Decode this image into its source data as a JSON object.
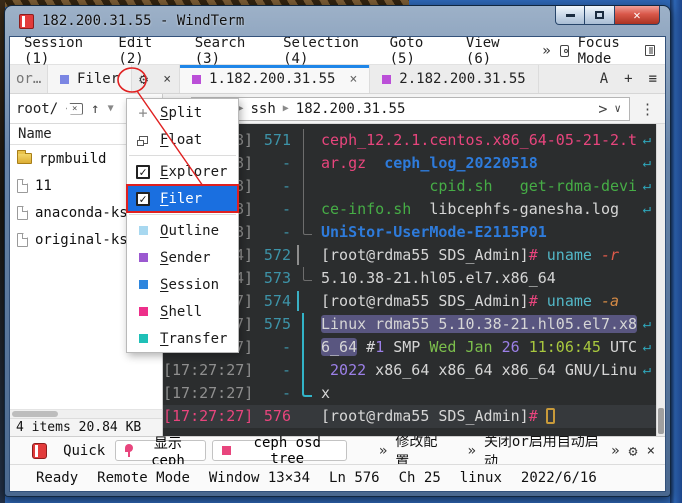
{
  "window": {
    "title": "182.200.31.55 - WindTerm"
  },
  "colors": {
    "pink": "#e8457d",
    "blue": "#2e7bdb",
    "green": "#46ad46",
    "white": "#d6d6d6",
    "cyan": "#52b7c7",
    "redit": "#e05a4a",
    "orangeit": "#d58a45",
    "violet": "#9c80e8",
    "green2": "#7cbf4c",
    "yellowgreen": "#a9c93e",
    "gray": "#8f8f8f",
    "teal": "#3d93a8",
    "wrap": "#2fa8bc",
    "annotation": "#e02020"
  },
  "menubar": {
    "items": [
      {
        "pre": "Session (",
        "key": "1",
        "post": ")"
      },
      {
        "pre": "Edit (",
        "key": "2",
        "post": ")"
      },
      {
        "pre": "Search (",
        "key": "3",
        "post": ")"
      },
      {
        "pre": "Selection (",
        "key": "4",
        "post": ")"
      },
      {
        "pre": "Goto (",
        "key": "5",
        "post": ")"
      },
      {
        "pre": "View (",
        "key": "6",
        "post": ")"
      }
    ],
    "overflow_glyph": "»",
    "focus_label": "Focus Mode"
  },
  "tabbar": {
    "left_tabs": [
      {
        "label": "or…",
        "muted": true
      },
      {
        "label": "Filer",
        "icon_color": "#7b86e3"
      }
    ],
    "gear_glyph": "⚙",
    "close_glyph": "×",
    "session_tabs": [
      {
        "label": "1.182.200.31.55",
        "icon_color": "#bb4fd8",
        "active": true,
        "closable": true
      },
      {
        "label": "2.182.200.31.55",
        "icon_color": "#bb4fd8",
        "active": false,
        "closable": false
      }
    ],
    "right_icons": [
      {
        "name": "font-size-icon",
        "glyph": "A"
      },
      {
        "name": "new-session-icon",
        "glyph": "+"
      },
      {
        "name": "session-list-icon",
        "glyph": "≡"
      }
    ]
  },
  "pathbar": {
    "path": "root/"
  },
  "addressbar": {
    "protocol": "ssh",
    "host": "182.200.31.55"
  },
  "popup_menu": {
    "items": [
      {
        "type": "icon",
        "icon": "split",
        "key": "S",
        "rest": "plit"
      },
      {
        "type": "icon",
        "icon": "float",
        "key": "F",
        "rest": "loat"
      },
      {
        "type": "check",
        "checked": true,
        "key": "E",
        "rest": "xplorer"
      },
      {
        "type": "check",
        "checked": true,
        "key": "F",
        "rest": "iler",
        "selected": true,
        "annotated": true
      },
      {
        "type": "color",
        "color": "#a8d8f0",
        "key": "O",
        "rest": "utline"
      },
      {
        "type": "color",
        "color": "#9b59d0",
        "key": "S",
        "rest": "ender"
      },
      {
        "type": "color",
        "color": "#2e86de",
        "key": "S",
        "rest": "ession"
      },
      {
        "type": "color",
        "color": "#ed2f8a",
        "key": "S",
        "rest": "hell"
      },
      {
        "type": "color",
        "color": "#1fc0b7",
        "key": "T",
        "rest": "ransfer"
      }
    ],
    "separators_after": [
      1,
      3
    ]
  },
  "sidebar": {
    "header": "Name",
    "files": [
      {
        "icon": "folder",
        "name": "rpmbuild"
      },
      {
        "icon": "file",
        "name": "11"
      },
      {
        "icon": "file",
        "name": "anaconda-ks.c"
      },
      {
        "icon": "file",
        "name": "original-ks.c"
      }
    ],
    "status": "4 items 20.84 KB"
  },
  "terminal": {
    "rows": [
      {
        "ts": "8]",
        "num": "571",
        "guide": "v",
        "wrap": true,
        "segs": [
          {
            "t": "ceph_12.2.1.centos.x86_64-05-21-2.t",
            "c": "pink"
          }
        ]
      },
      {
        "ts": "8]",
        "num": "-",
        "guide": "v",
        "wrap": true,
        "segs": [
          {
            "t": "ar.gz",
            "c": "pink"
          },
          {
            "t": "  ",
            "c": "white"
          },
          {
            "t": "ceph_log_20220518",
            "c": "blue"
          }
        ]
      },
      {
        "ts": "8]",
        "num": "-",
        "guide": "v",
        "wrap": true,
        "segs": [
          {
            "t": "            ",
            "c": "white"
          },
          {
            "t": "cpid.sh",
            "c": "green"
          },
          {
            "t": "   ",
            "c": "white"
          },
          {
            "t": "get-rdma-devi",
            "c": "green"
          }
        ]
      },
      {
        "ts": "8]",
        "num": "-",
        "guide": "v",
        "wrap": true,
        "segs": [
          {
            "t": "ce-info.sh",
            "c": "green"
          },
          {
            "t": "  ",
            "c": "white"
          },
          {
            "t": "libcephfs-ganesha.log",
            "c": "white"
          }
        ]
      },
      {
        "ts": "8]",
        "num": "-",
        "guide": "l",
        "segs": [
          {
            "t": "UniStor-UserMode-E2115P01",
            "c": "blue"
          }
        ]
      },
      {
        "ts": "4]",
        "num": "572",
        "fold": "gray",
        "segs": [
          {
            "t": "[root@rdma55 SDS_Admin]",
            "c": "white"
          },
          {
            "t": "#",
            "c": "pink"
          },
          {
            "t": " ",
            "c": "white"
          },
          {
            "t": "uname",
            "c": "cyan"
          },
          {
            "t": " ",
            "c": "white"
          },
          {
            "t": "-r",
            "c": "redit"
          }
        ]
      },
      {
        "ts": "4]",
        "num": "573",
        "guide": "l",
        "segs": [
          {
            "t": "5.10.38-21.hl05.el7.x86_64",
            "c": "white"
          }
        ]
      },
      {
        "ts": "7]",
        "num": "574",
        "fold": "teal",
        "segs": [
          {
            "t": "[root@rdma55 SDS_Admin]",
            "c": "white"
          },
          {
            "t": "#",
            "c": "pink"
          },
          {
            "t": " ",
            "c": "white"
          },
          {
            "t": "uname",
            "c": "cyan"
          },
          {
            "t": " ",
            "c": "white"
          },
          {
            "t": "-a",
            "c": "orangeit"
          }
        ]
      },
      {
        "ts": "7]",
        "num": "575",
        "guide": "vt",
        "wrap": true,
        "segs": [
          {
            "t": "Linux rdma55 5.10.38-21.hl05.el7.x8",
            "c": "white",
            "sel": true
          }
        ]
      },
      {
        "ts": "7]",
        "num": "-",
        "guide": "vt",
        "wrap": true,
        "segs": [
          {
            "t": "6_64",
            "c": "white",
            "sel": true
          },
          {
            "t": " ",
            "c": "white"
          },
          {
            "t": "#",
            "c": "white"
          },
          {
            "t": "1",
            "c": "violet"
          },
          {
            "t": " SMP ",
            "c": "white"
          },
          {
            "t": "Wed Jan",
            "c": "green2"
          },
          {
            "t": " ",
            "c": "white"
          },
          {
            "t": "26",
            "c": "violet"
          },
          {
            "t": " ",
            "c": "white"
          },
          {
            "t": "11:06:45",
            "c": "yellowgreen"
          },
          {
            "t": " ",
            "c": "white"
          },
          {
            "t": "UTC",
            "c": "white"
          }
        ]
      },
      {
        "ts": "[17:27:27]",
        "num": "-",
        "guide": "vt",
        "wrap": true,
        "segs": [
          {
            "t": " ",
            "c": "white"
          },
          {
            "t": "2022",
            "c": "violet"
          },
          {
            "t": " x86_64 x86_64 x86_64 GNU/Linu",
            "c": "white"
          }
        ]
      },
      {
        "ts": "[17:27:27]",
        "num": "-",
        "guide": "lt",
        "segs": [
          {
            "t": "x",
            "c": "white"
          }
        ]
      },
      {
        "ts": "[17:27:27]",
        "num": "576",
        "current": true,
        "cursor": true,
        "segs": [
          {
            "t": "[root@rdma55 SDS_Admin]",
            "c": "white"
          },
          {
            "t": "#",
            "c": "pink"
          }
        ]
      }
    ]
  },
  "quickbar": {
    "label": "Quick",
    "buttons": [
      {
        "icon": "pin",
        "label": "显示ceph"
      },
      {
        "icon": "square",
        "label": "ceph osd tree"
      }
    ],
    "collapsed_groups": [
      {
        "label": "修改配置"
      },
      {
        "label": "关闭or启用自动启动"
      }
    ]
  },
  "statusbar": {
    "items": [
      "Ready",
      "Remote Mode",
      "Window 13×34",
      "Ln 576",
      "Ch 25",
      "linux",
      "2022/6/16"
    ]
  }
}
